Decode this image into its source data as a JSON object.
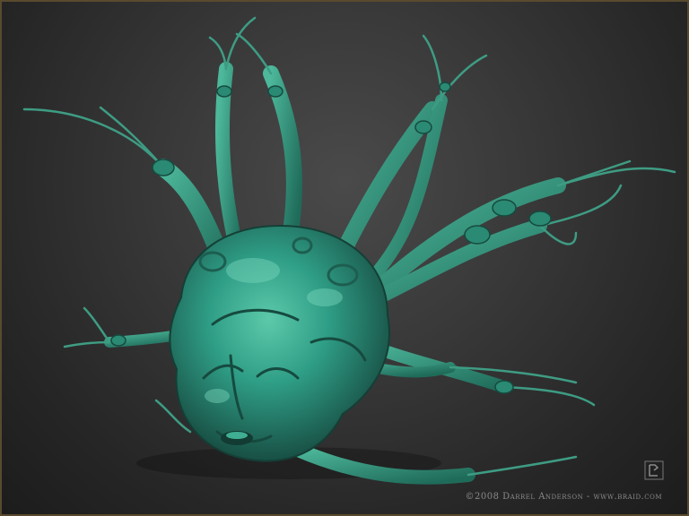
{
  "artwork": {
    "subject_icon": "tentacled-creature-head-icon",
    "colors": {
      "skin": "#2f9e86",
      "skin_light": "#55c4a6",
      "skin_dark": "#1d5e50",
      "background_center": "#4a4a4a",
      "background_edge": "#1c1c1c",
      "frame": "#5a4a2e"
    }
  },
  "watermark": {
    "text": "©2008 Darrel Anderson - www.braid.com",
    "logo_icon": "braid-logo-icon"
  }
}
